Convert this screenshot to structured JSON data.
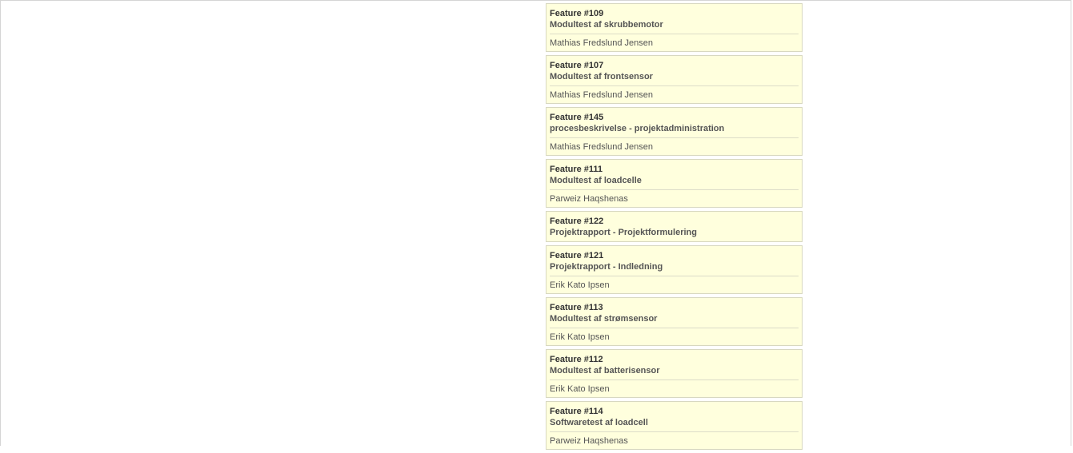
{
  "cards": [
    {
      "id": "Feature #109",
      "title": "Modultest af skrubbemotor",
      "assignee": "Mathias Fredslund Jensen"
    },
    {
      "id": "Feature #107",
      "title": "Modultest af frontsensor",
      "assignee": "Mathias Fredslund Jensen"
    },
    {
      "id": "Feature #145",
      "title": "procesbeskrivelse - projektadministration",
      "assignee": "Mathias Fredslund Jensen"
    },
    {
      "id": "Feature #111",
      "title": "Modultest af loadcelle",
      "assignee": "Parweiz Haqshenas"
    },
    {
      "id": "Feature #122",
      "title": "Projektrapport - Projektformulering",
      "assignee": ""
    },
    {
      "id": "Feature #121",
      "title": "Projektrapport - Indledning",
      "assignee": "Erik Kato Ipsen"
    },
    {
      "id": "Feature #113",
      "title": "Modultest af strømsensor",
      "assignee": "Erik Kato Ipsen"
    },
    {
      "id": "Feature #112",
      "title": "Modultest af batterisensor",
      "assignee": "Erik Kato Ipsen"
    },
    {
      "id": "Feature #114",
      "title": "Softwaretest af loadcell",
      "assignee": "Parweiz Haqshenas"
    }
  ]
}
